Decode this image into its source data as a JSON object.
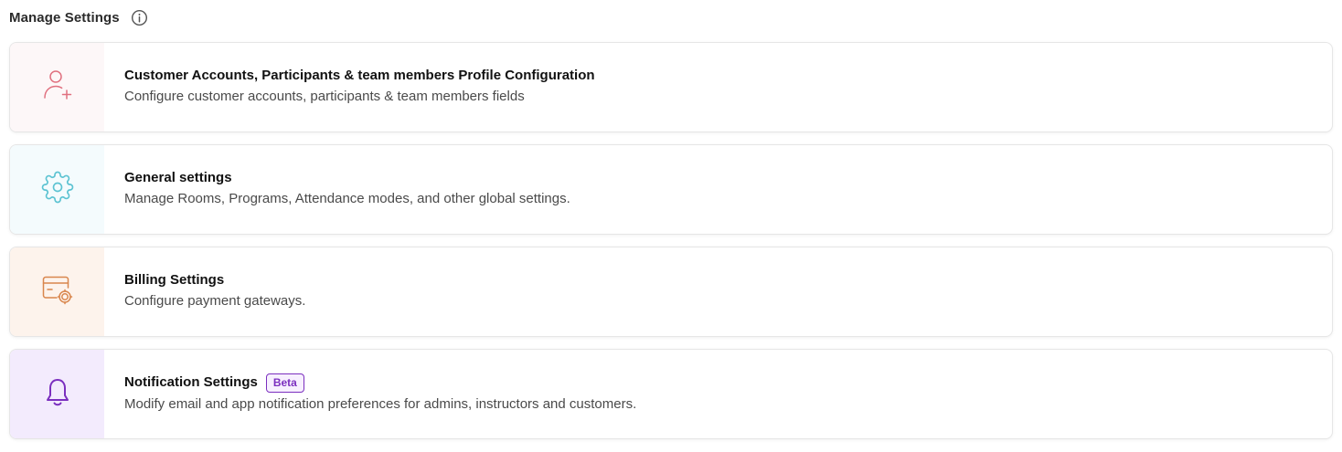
{
  "header": {
    "title": "Manage Settings",
    "info_icon": "info-icon"
  },
  "cards": [
    {
      "title": "Customer Accounts, Participants & team members Profile Configuration",
      "description": "Configure customer accounts, participants & team members fields",
      "icon": "user-plus-icon",
      "icon_color": "#e0707f",
      "icon_bg": "#fdf7f8"
    },
    {
      "title": "General settings",
      "description": "Manage Rooms, Programs, Attendance modes, and other global settings.",
      "icon": "gear-icon",
      "icon_color": "#5cc3d2",
      "icon_bg": "#f4fbfd"
    },
    {
      "title": "Billing Settings",
      "description": "Configure payment gateways.",
      "icon": "card-gear-icon",
      "icon_color": "#d9864d",
      "icon_bg": "#fdf3ec"
    },
    {
      "title": "Notification Settings",
      "description": "Modify email and app notification preferences for admins, instructors and customers.",
      "badge": "Beta",
      "icon": "bell-icon",
      "icon_color": "#7b2fbf",
      "icon_bg": "#f3ebfd"
    }
  ]
}
